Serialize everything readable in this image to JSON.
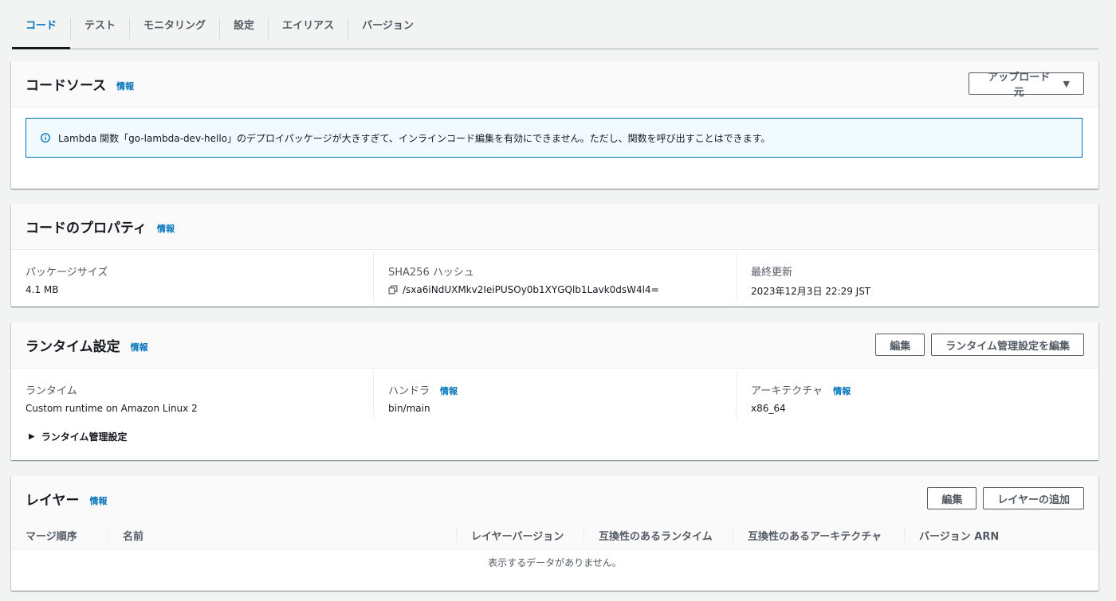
{
  "tabs": [
    {
      "label": "コード",
      "active": true
    },
    {
      "label": "テスト"
    },
    {
      "label": "モニタリング"
    },
    {
      "label": "設定"
    },
    {
      "label": "エイリアス"
    },
    {
      "label": "バージョン"
    }
  ],
  "info_label": "情報",
  "code_source": {
    "title": "コードソース",
    "upload_button": "アップロード元",
    "alert": "Lambda 関数「go-lambda-dev-hello」のデプロイパッケージが大きすぎて、インラインコード編集を有効にできません。ただし、関数を呼び出すことはできます。"
  },
  "code_properties": {
    "title": "コードのプロパティ",
    "package_size_label": "パッケージサイズ",
    "package_size": "4.1 MB",
    "hash_label": "SHA256 ハッシュ",
    "hash": "/sxa6iNdUXMkv2IeiPUSOy0b1XYGQlb1Lavk0dsW4l4=",
    "last_modified_label": "最終更新",
    "last_modified": "2023年12月3日 22:29 JST"
  },
  "runtime_settings": {
    "title": "ランタイム設定",
    "edit_button": "編集",
    "edit_mgmt_button": "ランタイム管理設定を編集",
    "runtime_label": "ランタイム",
    "runtime": "Custom runtime on Amazon Linux 2",
    "handler_label": "ハンドラ",
    "handler": "bin/main",
    "arch_label": "アーキテクチャ",
    "arch": "x86_64",
    "mgmt_expander": "ランタイム管理設定"
  },
  "layers": {
    "title": "レイヤー",
    "edit_button": "編集",
    "add_button": "レイヤーの追加",
    "columns": [
      "マージ順序",
      "名前",
      "レイヤーバージョン",
      "互換性のあるランタイム",
      "互換性のあるアーキテクチャ",
      "バージョン ARN"
    ],
    "empty": "表示するデータがありません。"
  },
  "colors": {
    "accent": "#0073bb",
    "alert_bg": "#f1faff"
  }
}
